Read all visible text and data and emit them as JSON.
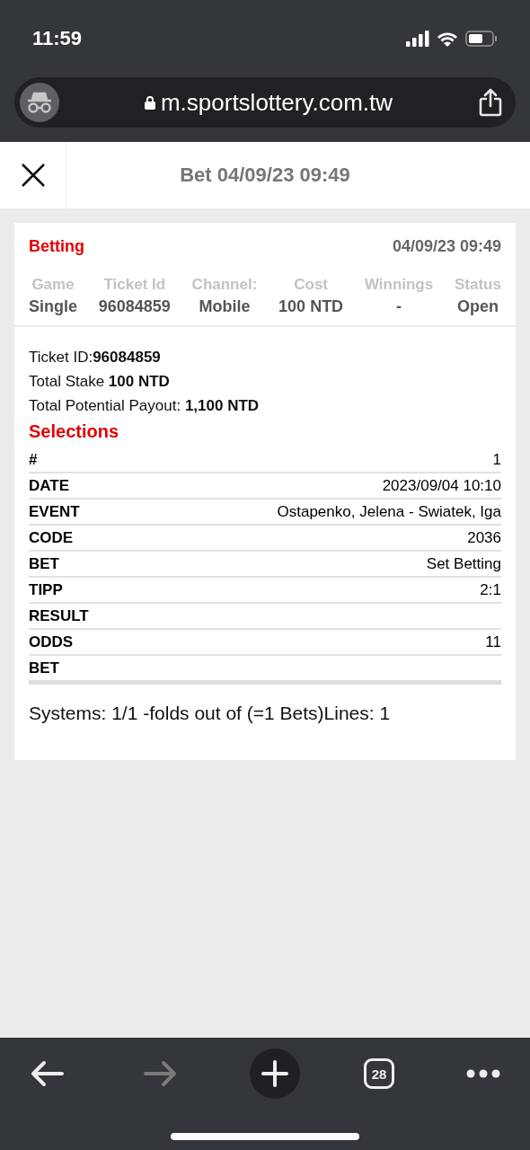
{
  "status_bar": {
    "time": "11:59"
  },
  "address_bar": {
    "url": "m.sportslottery.com.tw"
  },
  "header": {
    "title": "Bet 04/09/23 09:49"
  },
  "summary": {
    "title": "Betting",
    "datetime": "04/09/23 09:49",
    "columns": [
      {
        "label": "Game",
        "value": "Single"
      },
      {
        "label": "Ticket Id",
        "value": "96084859"
      },
      {
        "label": "Channel:",
        "value": "Mobile"
      },
      {
        "label": "Cost",
        "value": "100 NTD"
      },
      {
        "label": "Winnings",
        "value": "-"
      },
      {
        "label": "Status",
        "value": "Open"
      }
    ]
  },
  "details": {
    "lines": [
      "Ticket ID:**96084859**",
      "Total Stake **100 NTD**",
      "Total Potential Payout: **1,100 NTD**"
    ],
    "selections_title": "Selections",
    "rows": [
      {
        "label": "#",
        "value": "1"
      },
      {
        "label": "DATE",
        "value": "2023/09/04 10:10"
      },
      {
        "label": "EVENT",
        "value": "Ostapenko, Jelena - Swiatek, Iga"
      },
      {
        "label": "CODE",
        "value": "2036"
      },
      {
        "label": "BET",
        "value": "Set Betting"
      },
      {
        "label": "TIPP",
        "value": "2:1"
      },
      {
        "label": "RESULT"
      },
      {
        "label": "ODDS",
        "value": "11"
      },
      {
        "label": "BET"
      }
    ],
    "footer": "Systems: 1/1 -folds out of (=1 Bets)Lines: 1"
  },
  "toolbar": [
    {
      "kind": "back",
      "disabled": false
    },
    {
      "kind": "forward",
      "disabled": true
    },
    {
      "kind": "new_tab",
      "disabled": false
    },
    {
      "kind": "tabs",
      "label": "28",
      "disabled": false
    },
    {
      "kind": "more",
      "disabled": false
    }
  ]
}
